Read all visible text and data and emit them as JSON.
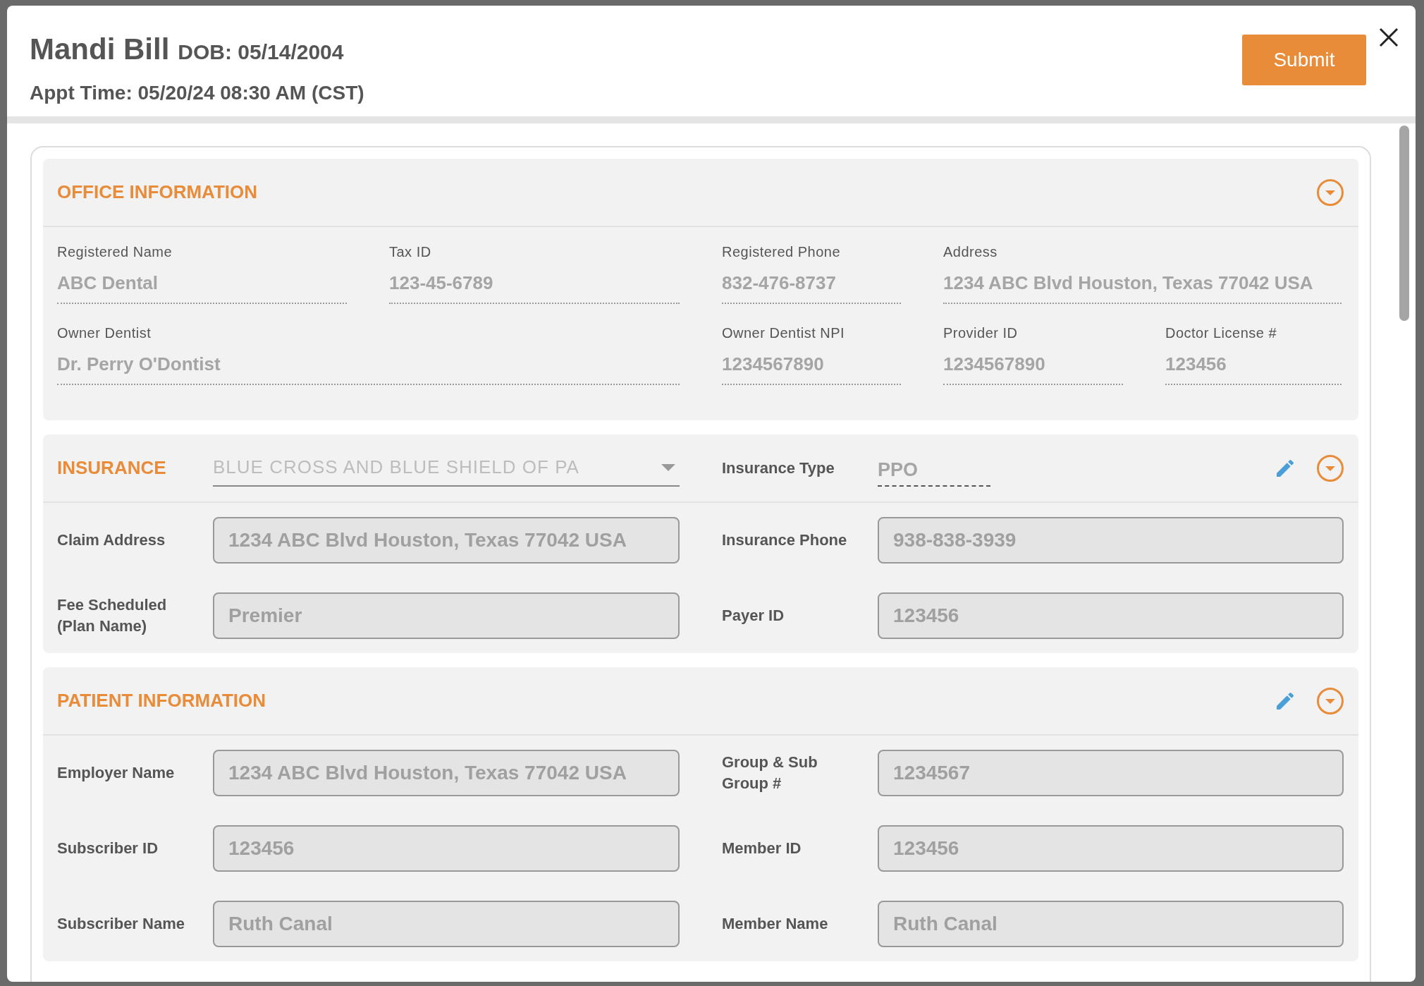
{
  "header": {
    "name": "Mandi Bill",
    "dob": "DOB: 05/14/2004",
    "appt": "Appt Time: 05/20/24 08:30 AM (CST)"
  },
  "submit": "Submit",
  "office": {
    "title": "OFFICE INFORMATION",
    "rows": [
      [
        {
          "label": "Registered Name",
          "value": "ABC Dental"
        },
        {
          "label": "Tax ID",
          "value": "123-45-6789"
        },
        {
          "label": "Registered Phone",
          "value": "832-476-8737"
        },
        {
          "label": "Address",
          "value": "1234 ABC Blvd Houston, Texas 77042 USA"
        },
        null
      ],
      [
        {
          "label": "Owner Dentist",
          "value": "Dr. Perry O'Dontist"
        },
        null,
        {
          "label": "Owner Dentist NPI",
          "value": "1234567890"
        },
        {
          "label": "Provider ID",
          "value": "1234567890"
        },
        {
          "label": "Doctor License #",
          "value": "123456"
        }
      ]
    ]
  },
  "insurance": {
    "title": "INSURANCE",
    "carrier": "BLUE CROSS AND BLUE SHIELD OF PA",
    "type_label": "Insurance Type",
    "type_value": "PPO",
    "rows": [
      [
        {
          "label": "Claim Address",
          "value": "1234 ABC Blvd Houston, Texas 77042 USA"
        },
        {
          "label": "Insurance Phone",
          "value": "938-838-3939"
        }
      ],
      [
        {
          "label": "Fee Scheduled (Plan Name)",
          "value": "Premier"
        },
        {
          "label": "Payer ID",
          "value": "123456"
        }
      ]
    ]
  },
  "patient": {
    "title": "PATIENT INFORMATION",
    "rows": [
      [
        {
          "label": "Employer Name",
          "value": "1234 ABC Blvd Houston, Texas 77042 USA"
        },
        {
          "label": "Group & Sub Group #",
          "value": "1234567"
        }
      ],
      [
        {
          "label": "Subscriber ID",
          "value": "123456"
        },
        {
          "label": "Member ID",
          "value": "123456"
        }
      ],
      [
        {
          "label": "Subscriber Name",
          "value": "Ruth Canal"
        },
        {
          "label": "Member Name",
          "value": "Ruth Canal"
        }
      ]
    ]
  }
}
